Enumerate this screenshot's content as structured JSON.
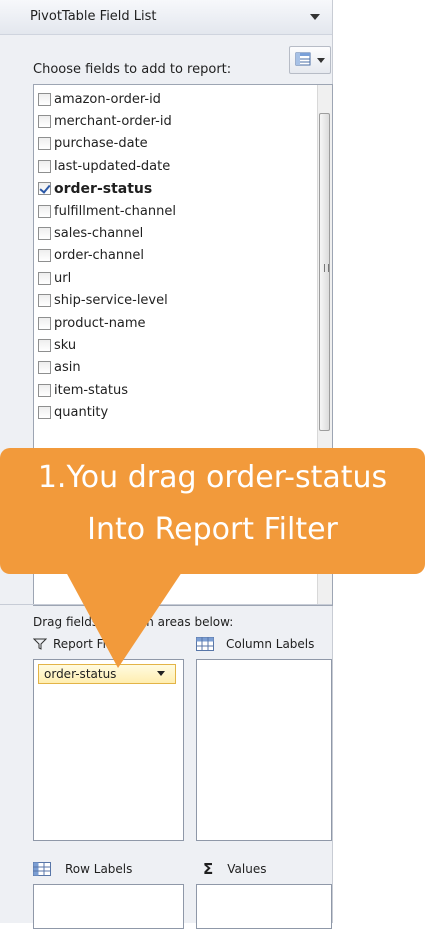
{
  "pane": {
    "title": "PivotTable Field List",
    "choose_label": "Choose fields to add to report:"
  },
  "fields": [
    {
      "label": "amazon-order-id",
      "checked": false
    },
    {
      "label": "merchant-order-id",
      "checked": false
    },
    {
      "label": "purchase-date",
      "checked": false
    },
    {
      "label": "last-updated-date",
      "checked": false
    },
    {
      "label": "order-status",
      "checked": true
    },
    {
      "label": "fulfillment-channel",
      "checked": false
    },
    {
      "label": "sales-channel",
      "checked": false
    },
    {
      "label": "order-channel",
      "checked": false
    },
    {
      "label": "url",
      "checked": false
    },
    {
      "label": "ship-service-level",
      "checked": false
    },
    {
      "label": "product-name",
      "checked": false
    },
    {
      "label": "sku",
      "checked": false
    },
    {
      "label": "asin",
      "checked": false
    },
    {
      "label": "item-status",
      "checked": false
    },
    {
      "label": "quantity",
      "checked": false
    }
  ],
  "areas": {
    "drag_label": "Drag fields between areas below:",
    "report_filter": "Report Filter",
    "column_labels": "Column Labels",
    "row_labels": "Row Labels",
    "values": "Values",
    "filter_chip": "order-status"
  },
  "callout": {
    "line1": "1.You drag order-status",
    "line2": "Into Report Filter"
  },
  "colors": {
    "callout": "#f29a3b",
    "chip_border": "#e3b447"
  }
}
